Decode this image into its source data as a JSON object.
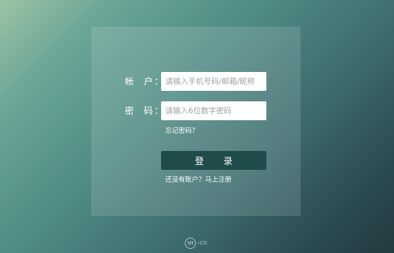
{
  "login_form": {
    "account_label": "帐  户：",
    "account_placeholder": "请输入手机号码/邮箱/昵称",
    "password_label": "密  码：",
    "password_placeholder": "请输入6位数字密码",
    "forgot_password_link": "忘记密码？",
    "login_button": "登 录",
    "register_link": "还没有账户？马上注册"
  },
  "watermark": {
    "badge_text": "UI",
    "site_text": "-cn"
  },
  "colors": {
    "button_background": "#1f4c4b",
    "gradient_light": "#9cc3a4",
    "gradient_dark": "#233a40"
  }
}
